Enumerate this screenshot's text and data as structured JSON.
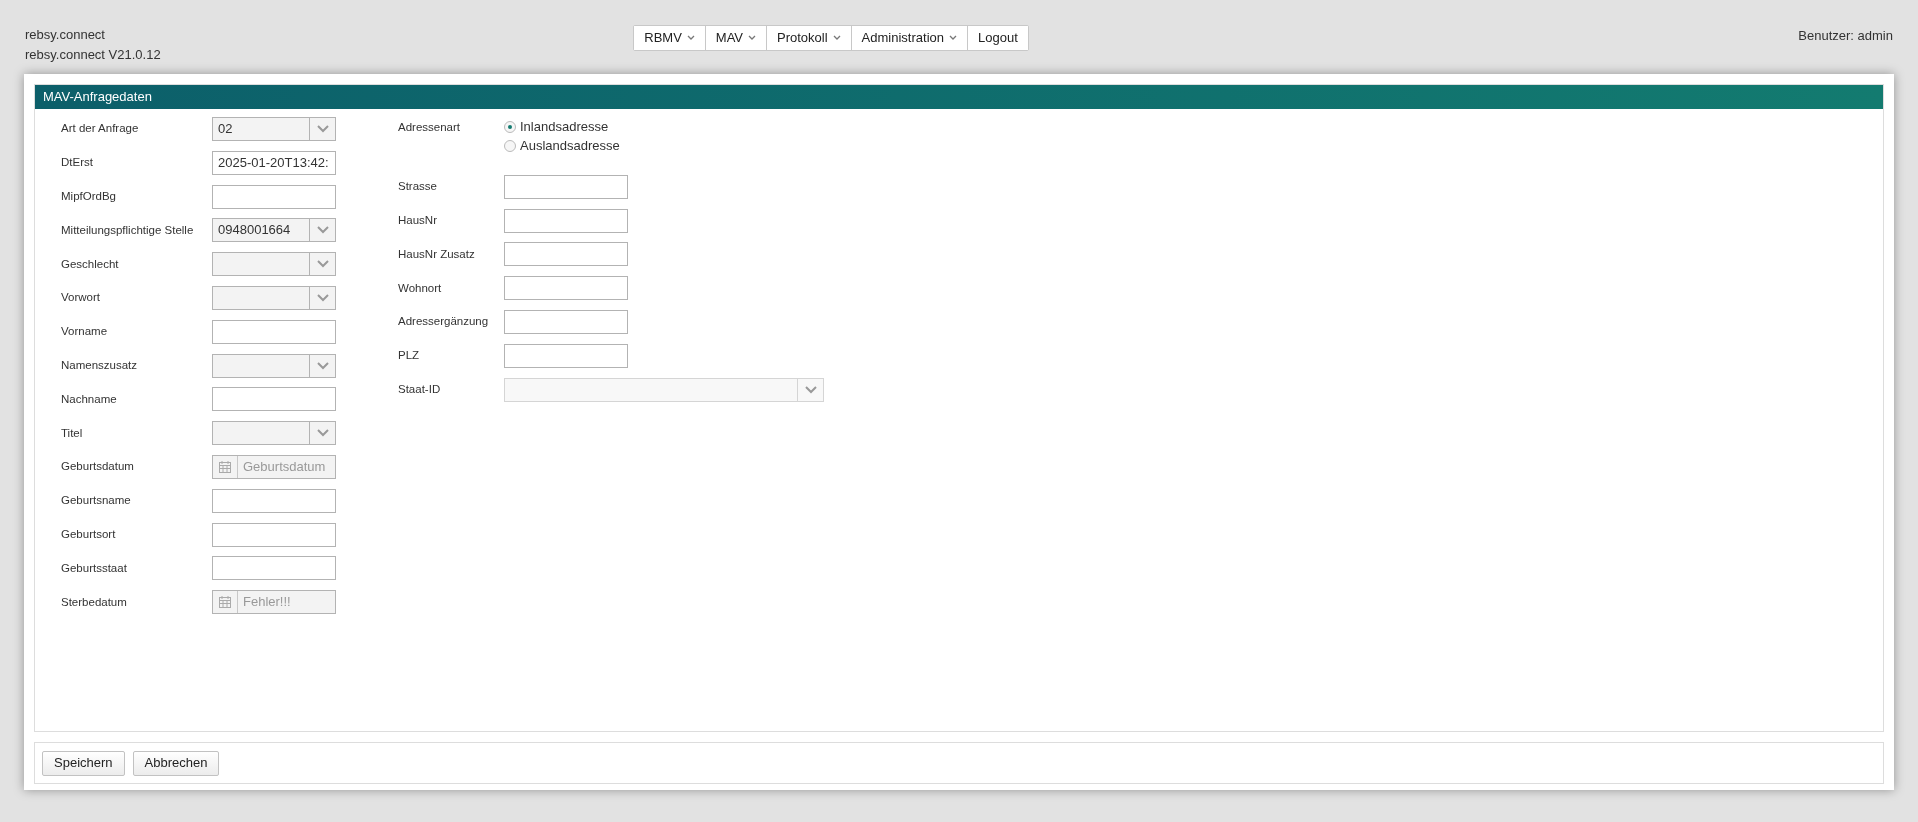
{
  "app": {
    "name": "rebsy.connect",
    "version": "rebsy.connect V21.0.12"
  },
  "menu": [
    {
      "label": "RBMV",
      "dropdown": true
    },
    {
      "label": "MAV",
      "dropdown": true
    },
    {
      "label": "Protokoll",
      "dropdown": true
    },
    {
      "label": "Administration",
      "dropdown": true
    },
    {
      "label": "Logout",
      "dropdown": false
    }
  ],
  "user": "Benutzer: admin",
  "panel": {
    "title": "MAV-Anfragedaten"
  },
  "left_fields": [
    {
      "label": "Art der Anfrage",
      "kind": "select",
      "value": "02"
    },
    {
      "label": "DtErst",
      "kind": "text",
      "value": "2025-01-20T13:42:"
    },
    {
      "label": "MipfOrdBg",
      "kind": "text"
    },
    {
      "label": "Mitteilungspflichtige Stelle",
      "kind": "select",
      "value": "0948001664"
    },
    {
      "label": "Geschlecht",
      "kind": "select"
    },
    {
      "label": "Vorwort",
      "kind": "select"
    },
    {
      "label": "Vorname",
      "kind": "text"
    },
    {
      "label": "Namenszusatz",
      "kind": "select"
    },
    {
      "label": "Nachname",
      "kind": "text"
    },
    {
      "label": "Titel",
      "kind": "select"
    },
    {
      "label": "Geburtsdatum",
      "kind": "date",
      "placeholder": "Geburtsdatum"
    },
    {
      "label": "Geburtsname",
      "kind": "text"
    },
    {
      "label": "Geburtsort",
      "kind": "text"
    },
    {
      "label": "Geburtsstaat",
      "kind": "text"
    },
    {
      "label": "Sterbedatum",
      "kind": "date",
      "placeholder": "Fehler!!!"
    }
  ],
  "address_type": {
    "label": "Adressenart",
    "options": [
      {
        "label": "Inlandsadresse",
        "selected": true
      },
      {
        "label": "Auslandsadresse",
        "selected": false
      }
    ]
  },
  "right_fields": [
    {
      "label": "Strasse",
      "kind": "text"
    },
    {
      "label": "HausNr",
      "kind": "text"
    },
    {
      "label": "HausNr Zusatz",
      "kind": "text"
    },
    {
      "label": "Wohnort",
      "kind": "text"
    },
    {
      "label": "Adressergänzung",
      "kind": "text"
    },
    {
      "label": "PLZ",
      "kind": "text"
    },
    {
      "label": "Staat-ID",
      "kind": "wide_select"
    }
  ],
  "buttons": [
    "Speichern",
    "Abbrechen"
  ]
}
